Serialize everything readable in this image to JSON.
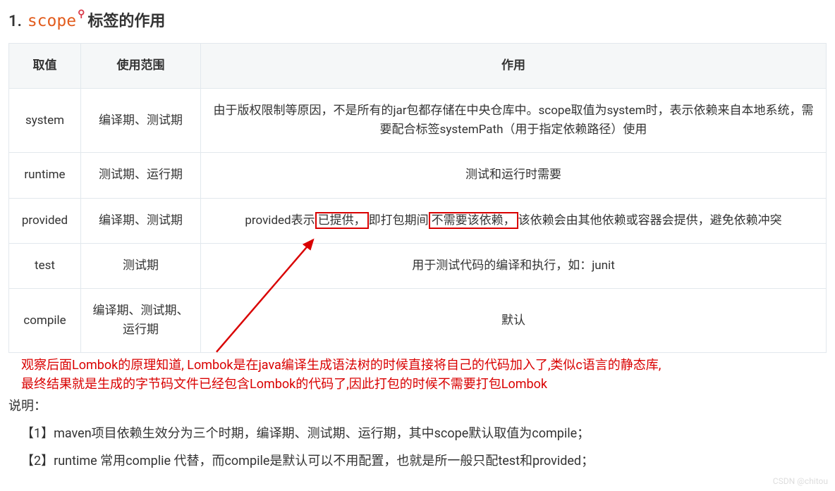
{
  "heading": {
    "number": "1.",
    "scope_word": "scope",
    "mag_icon": "⚲",
    "rest": "标签的作用"
  },
  "table": {
    "headers": {
      "col1": "取值",
      "col2": "使用范围",
      "col3": "作用"
    },
    "rows": [
      {
        "col1": "system",
        "col2": "编译期、测试期",
        "col3": "由于版权限制等原因，不是所有的jar包都存储在中央仓库中。scope取值为system时，表示依赖来自本地系统，需要配合标签systemPath（用于指定依赖路径）使用"
      },
      {
        "col1": "runtime",
        "col2": "测试期、运行期",
        "col3": "测试和运行时需要"
      },
      {
        "col1": "provided",
        "col2": "编译期、测试期",
        "col3_parts": {
          "p1": "provided表示",
          "box1": "已提供，",
          "p2": "即打包期间",
          "box2": "不需要该依赖，",
          "p3": "该依赖会由其他依赖或容器会提供，避免依赖冲突"
        }
      },
      {
        "col1": "test",
        "col2": "测试期",
        "col3": "用于测试代码的编译和执行，如：junit"
      },
      {
        "col1": "compile",
        "col2": "编译期、测试期、运行期",
        "col3": "默认"
      }
    ]
  },
  "annotation": {
    "line1": "观察后面Lombok的原理知道, Lombok是在java编译生成语法树的时候直接将自己的代码加入了,类似c语言的静态库,",
    "line2": "最终结果就是生成的字节码文件已经包含Lombok的代码了,因此打包的时候不需要打包Lombok"
  },
  "description": {
    "label": "说明：",
    "item1": "【1】maven项目依赖生效分为三个时期，编译期、测试期、运行期，其中scope默认取值为compile；",
    "item2": "【2】runtime 常用complie 代替，而compile是默认可以不用配置，也就是所一般只配test和provided；"
  },
  "watermark": "CSDN @chitou"
}
